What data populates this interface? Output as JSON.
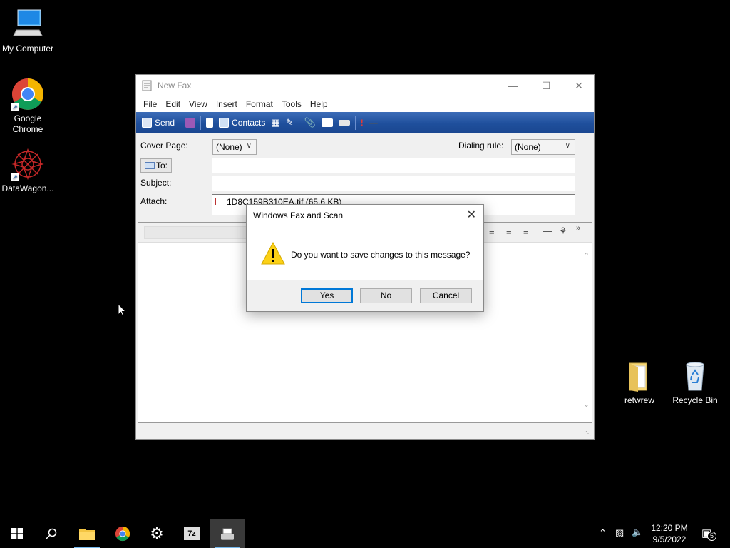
{
  "desktop": {
    "icons": [
      {
        "label": "My Computer"
      },
      {
        "label": "Google Chrome"
      },
      {
        "label": "DataWagon..."
      },
      {
        "label": "retwrew"
      },
      {
        "label": "Recycle Bin"
      }
    ]
  },
  "fax_window": {
    "title": "New Fax",
    "menu": [
      "File",
      "Edit",
      "View",
      "Insert",
      "Format",
      "Tools",
      "Help"
    ],
    "toolbar": {
      "send": "Send",
      "contacts": "Contacts"
    },
    "cover_page_label": "Cover Page:",
    "cover_page_value": "(None)",
    "dialing_rule_label": "Dialing rule:",
    "dialing_rule_value": "(None)",
    "to_button": "To:",
    "to_value": "",
    "subject_label": "Subject:",
    "subject_value": "",
    "attach_label": "Attach:",
    "attachment": "1D8C159B310EA.tif (65.6 KB)"
  },
  "dialog": {
    "title": "Windows Fax and Scan",
    "message": "Do you want to save changes to this message?",
    "yes": "Yes",
    "no": "No",
    "cancel": "Cancel"
  },
  "taskbar": {
    "time": "12:20 PM",
    "date": "9/5/2022",
    "notification_count": "5"
  }
}
